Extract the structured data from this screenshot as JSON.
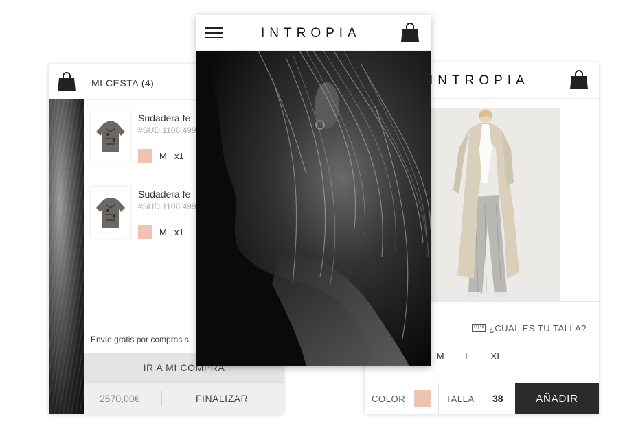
{
  "colors": {
    "accent_swatch": "#efc3b1",
    "dark_button": "#2b2b2b",
    "panel_grey": "#e4e4e4"
  },
  "cart": {
    "bag_icon": "shopping-bag-icon",
    "title": "MI CESTA (4)",
    "items": [
      {
        "name": "Sudadera fe",
        "ref": "#SUD.1108.499",
        "size": "M",
        "qty": "x1"
      },
      {
        "name": "Sudadera fe",
        "ref": "#SUD.1108.499",
        "size": "M",
        "qty": "x1"
      }
    ],
    "shipping_note": "Envío gratis por compras s",
    "checkout_label": "IR A MI COMPRA",
    "total": "2570,00€",
    "finalize_label": "FINALIZAR"
  },
  "hero": {
    "menu_icon": "hamburger-menu-icon",
    "logo": "INTROPIA",
    "bag_icon": "shopping-bag-icon"
  },
  "product": {
    "logo": "INTROPIA",
    "bag_icon": "shopping-bag-icon",
    "size_guide_icon": "ruler-icon",
    "size_guide_label": "¿CUÁL ES TU TALLA?",
    "sizes": [
      "M",
      "L",
      "XL"
    ],
    "color_label": "COLOR",
    "size_label": "TALLA",
    "selected_size": "38",
    "add_label": "AÑADIR"
  }
}
